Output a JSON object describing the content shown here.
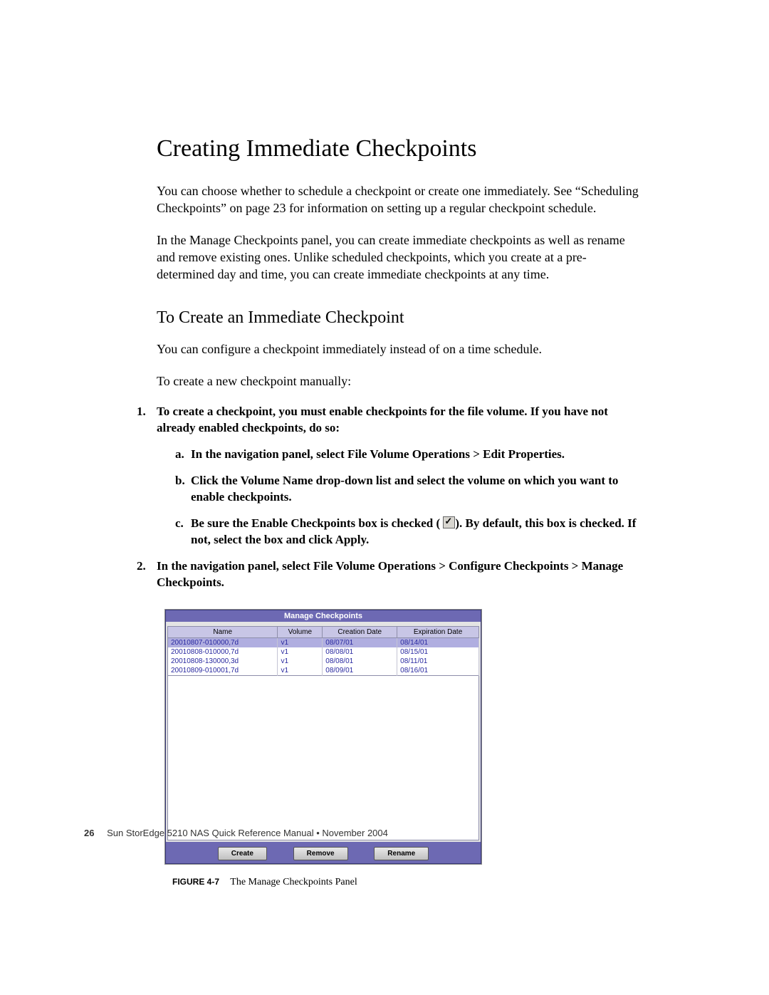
{
  "heading": "Creating Immediate Checkpoints",
  "para1": "You can choose whether to schedule a checkpoint or create one immediately. See “Scheduling Checkpoints” on page 23 for information on setting up a regular checkpoint schedule.",
  "para2": "In the Manage Checkpoints panel, you can create immediate checkpoints as well as rename and remove existing ones. Unlike scheduled checkpoints, which you create at a pre-determined day and time, you can create immediate checkpoints at any time.",
  "subheading": "To Create an Immediate Checkpoint",
  "para3": "You can configure a checkpoint immediately instead of on a time schedule.",
  "para4": "To create a new checkpoint manually:",
  "step1": {
    "num": "1.",
    "text": "To create a checkpoint, you must enable checkpoints for the file volume. If you have not already enabled checkpoints, do so:",
    "a": {
      "letter": "a.",
      "text": "In the navigation panel, select File Volume Operations > Edit Properties."
    },
    "b": {
      "letter": "b.",
      "text": "Click the Volume Name drop-down list and select the volume on which you want to enable checkpoints."
    },
    "c": {
      "letter": "c.",
      "pre": "Be sure the Enable Checkpoints box is checked (",
      "post": "). By default, this box is checked. If not, select the box and click Apply."
    }
  },
  "step2": {
    "num": "2.",
    "text": "In the navigation panel, select File Volume Operations > Configure Checkpoints > Manage Checkpoints."
  },
  "panel": {
    "title": "Manage Checkpoints",
    "headers": {
      "name": "Name",
      "volume": "Volume",
      "creation": "Creation Date",
      "expiration": "Expiration Date"
    },
    "rows": [
      {
        "name": "20010807-010000,7d",
        "volume": "v1",
        "creation": "08/07/01",
        "expiration": "08/14/01"
      },
      {
        "name": "20010808-010000,7d",
        "volume": "v1",
        "creation": "08/08/01",
        "expiration": "08/15/01"
      },
      {
        "name": "20010808-130000,3d",
        "volume": "v1",
        "creation": "08/08/01",
        "expiration": "08/11/01"
      },
      {
        "name": "20010809-010001,7d",
        "volume": "v1",
        "creation": "08/09/01",
        "expiration": "08/16/01"
      }
    ],
    "buttons": {
      "create": "Create",
      "remove": "Remove",
      "rename": "Rename"
    }
  },
  "caption": {
    "label": "FIGURE 4-7",
    "text": "The Manage Checkpoints Panel"
  },
  "footer": {
    "page": "26",
    "text": "Sun StorEdge 5210 NAS Quick Reference Manual  •  November 2004"
  }
}
